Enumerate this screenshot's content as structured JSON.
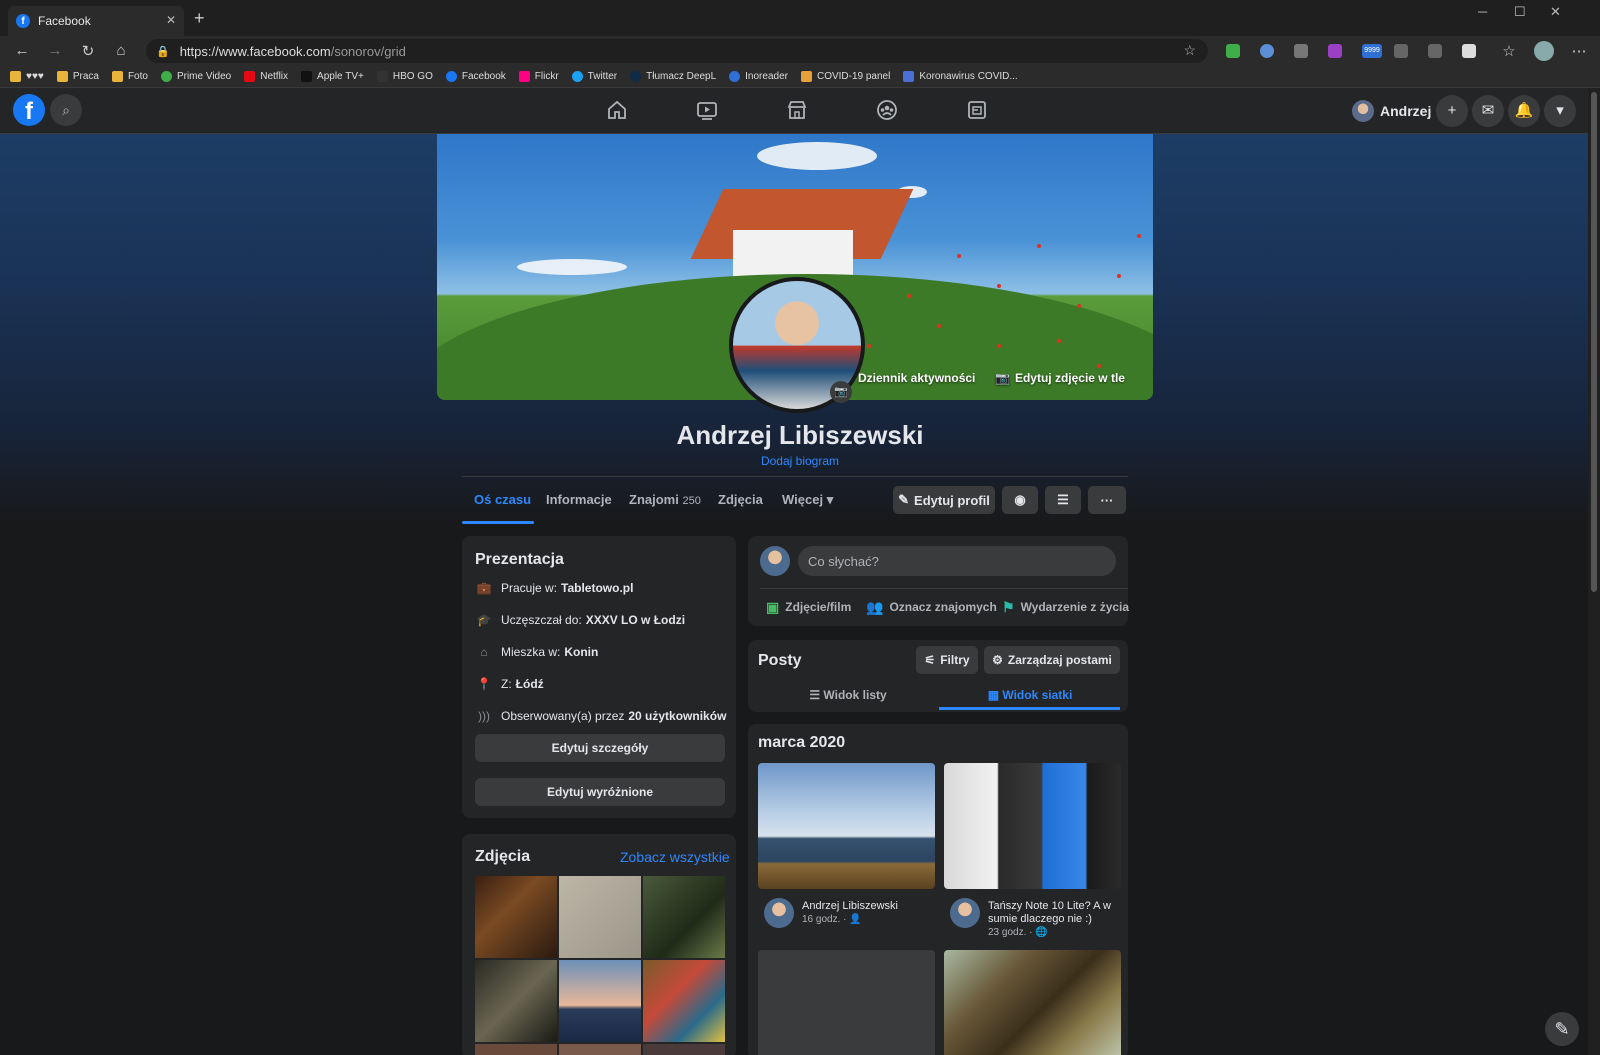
{
  "browser": {
    "tab_title": "Facebook",
    "url_domain": "https://www.facebook.com",
    "url_path": "/sonorov/grid",
    "bookmarks": [
      "♥♥♥",
      "Praca",
      "Foto",
      "Prime Video",
      "Netflix",
      "Apple TV+",
      "HBO GO",
      "Facebook",
      "Flickr",
      "Twitter",
      "Tłumacz DeepL",
      "Inoreader",
      "COVID-19 panel",
      "Koronawirus COVID..."
    ],
    "badge_count": "9999"
  },
  "fb": {
    "logo": "f",
    "user_name": "Andrzej"
  },
  "profile": {
    "name": "Andrzej Libiszewski",
    "bio_link": "Dodaj biogram",
    "activity_log": "Dziennik aktywności",
    "edit_cover": "Edytuj zdjęcie w tle",
    "tabs": {
      "timeline": "Oś czasu",
      "info": "Informacje",
      "friends": "Znajomi",
      "friends_count": "250",
      "photos": "Zdjęcia",
      "more": "Więcej"
    },
    "edit_profile": "Edytuj profil"
  },
  "intro": {
    "title": "Prezentacja",
    "work_label": "Pracuje w:",
    "work_value": "Tabletowo.pl",
    "school_label": "Uczęszczał do:",
    "school_value": "XXXV LO w Łodzi",
    "lives_label": "Mieszka w:",
    "lives_value": "Konin",
    "from_label": "Z:",
    "from_value": "Łódź",
    "followers_label": "Obserwowany(a) przez",
    "followers_value": "20 użytkowników",
    "edit_details": "Edytuj szczegóły",
    "edit_featured": "Edytuj wyróżnione"
  },
  "photos": {
    "title": "Zdjęcia",
    "see_all": "Zobacz wszystkie"
  },
  "composer": {
    "placeholder": "Co słychać?",
    "photo_video": "Zdjęcie/film",
    "tag_friends": "Oznacz znajomych",
    "life_event": "Wydarzenie z życia"
  },
  "posts": {
    "title": "Posty",
    "filters": "Filtry",
    "manage": "Zarządzaj postami",
    "list_view": "Widok listy",
    "grid_view": "Widok siatki",
    "month": "marca 2020",
    "items": [
      {
        "title": "Andrzej Libiszewski",
        "time": "16 godz. · "
      },
      {
        "title": "Tańszy Note 10 Lite? A w sumie dlaczego nie :)",
        "time": "23 godz. · "
      }
    ]
  }
}
